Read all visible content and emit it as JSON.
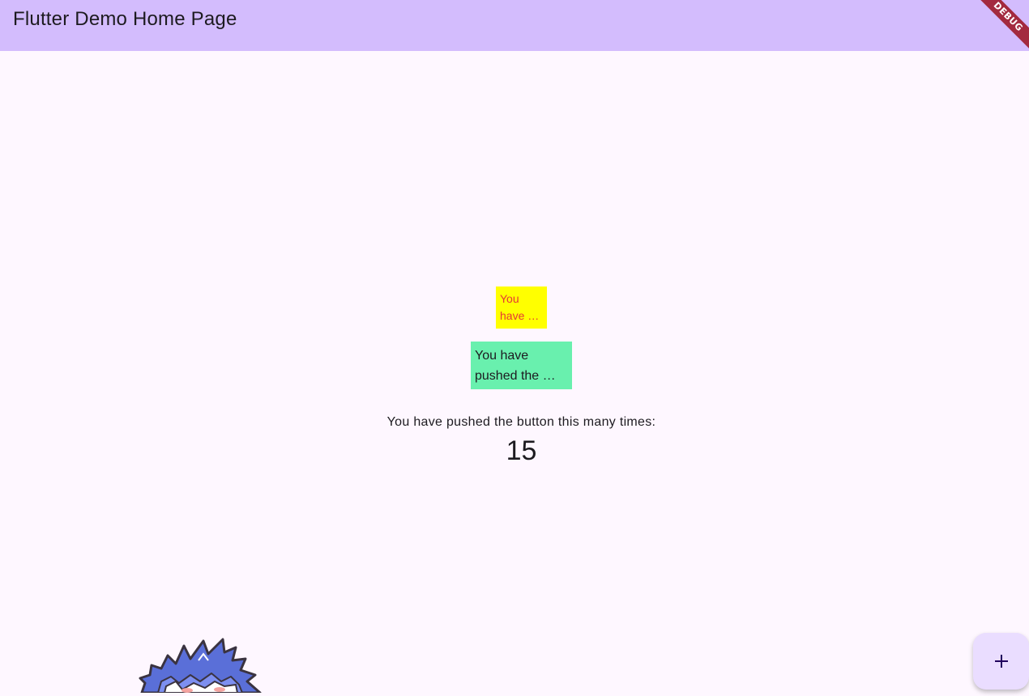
{
  "appbar": {
    "title": "Flutter Demo Home Page",
    "background": "#d3bcfd"
  },
  "debug_banner": {
    "label": "DEBUG",
    "color": "#a32a3f"
  },
  "main": {
    "yellow_box": {
      "text": "You have …",
      "background": "#ffff00",
      "text_color": "#e53935"
    },
    "green_box": {
      "text": "You have pushed the …",
      "background": "#69f0ae"
    },
    "counter_label": "You have pushed the button this many times:",
    "counter_value": "15"
  },
  "fab": {
    "icon": "add-icon",
    "background": "#eaddff"
  },
  "mascot": {
    "icon": "anime-character-image"
  }
}
